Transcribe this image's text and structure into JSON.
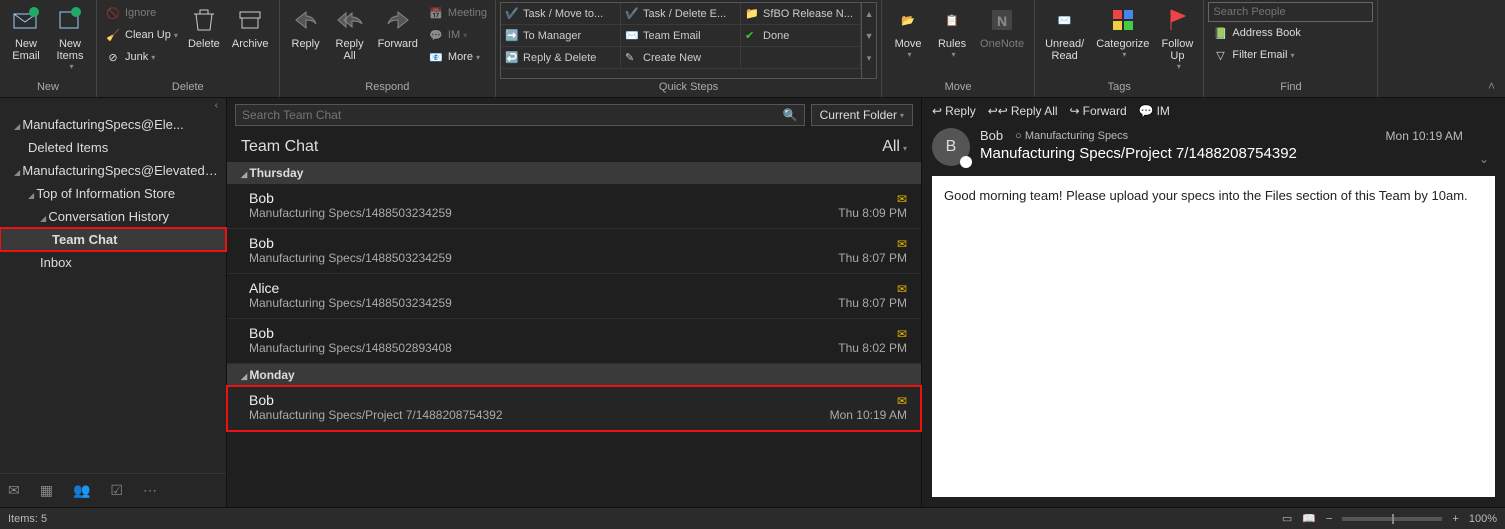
{
  "ribbon": {
    "groups": {
      "new": {
        "label": "New",
        "new_email": "New\nEmail",
        "new_items": "New\nItems"
      },
      "delete": {
        "label": "Delete",
        "ignore": "Ignore",
        "cleanup": "Clean Up",
        "junk": "Junk",
        "delete": "Delete",
        "archive": "Archive"
      },
      "respond": {
        "label": "Respond",
        "reply": "Reply",
        "reply_all": "Reply\nAll",
        "forward": "Forward",
        "meeting": "Meeting",
        "im": "IM",
        "more": "More"
      },
      "quick": {
        "label": "Quick Steps",
        "items": [
          "Task / Move to...",
          "Task / Delete E...",
          "SfBO Release N...",
          "To Manager",
          "Team Email",
          "Done",
          "Reply & Delete",
          "Create New",
          ""
        ]
      },
      "move": {
        "label": "Move",
        "move": "Move",
        "rules": "Rules",
        "onenote": "OneNote"
      },
      "tags": {
        "label": "Tags",
        "unread": "Unread/\nRead",
        "categorize": "Categorize",
        "followup": "Follow\nUp"
      },
      "find": {
        "label": "Find",
        "search_placeholder": "Search People",
        "address_book": "Address Book",
        "filter": "Filter Email"
      }
    }
  },
  "folders": {
    "account1": "ManufacturingSpecs@Ele...",
    "deleted": "Deleted Items",
    "account2": "ManufacturingSpecs@ElevatedR...",
    "top": "Top of Information Store",
    "conv": "Conversation History",
    "teamchat": "Team Chat",
    "inbox": "Inbox"
  },
  "search": {
    "placeholder": "Search Team Chat",
    "scope": "Current Folder"
  },
  "list": {
    "title": "Team Chat",
    "filter": "All",
    "groups": [
      {
        "name": "Thursday",
        "items": [
          {
            "from": "Bob",
            "subj": "Manufacturing Specs/1488503234259",
            "time": "Thu 8:09 PM"
          },
          {
            "from": "Bob",
            "subj": "Manufacturing Specs/1488503234259",
            "time": "Thu 8:07 PM"
          },
          {
            "from": "Alice",
            "subj": "Manufacturing Specs/1488503234259",
            "time": "Thu 8:07 PM"
          },
          {
            "from": "Bob",
            "subj": "Manufacturing Specs/1488502893408",
            "time": "Thu 8:02 PM"
          }
        ]
      },
      {
        "name": "Monday",
        "items": [
          {
            "from": "Bob",
            "subj": "Manufacturing Specs/Project 7/1488208754392",
            "time": "Mon 10:19 AM",
            "selected": true
          }
        ]
      }
    ]
  },
  "reading": {
    "actions": {
      "reply": "Reply",
      "reply_all": "Reply All",
      "forward": "Forward",
      "im": "IM"
    },
    "from": "Bob",
    "avatar_initial": "B",
    "category": "Manufacturing Specs",
    "subject": "Manufacturing Specs/Project 7/1488208754392",
    "time": "Mon 10:19 AM",
    "body": "Good morning team! Please upload your specs into the Files section of this Team by 10am."
  },
  "status": {
    "items": "Items: 5",
    "zoom": "100%"
  }
}
